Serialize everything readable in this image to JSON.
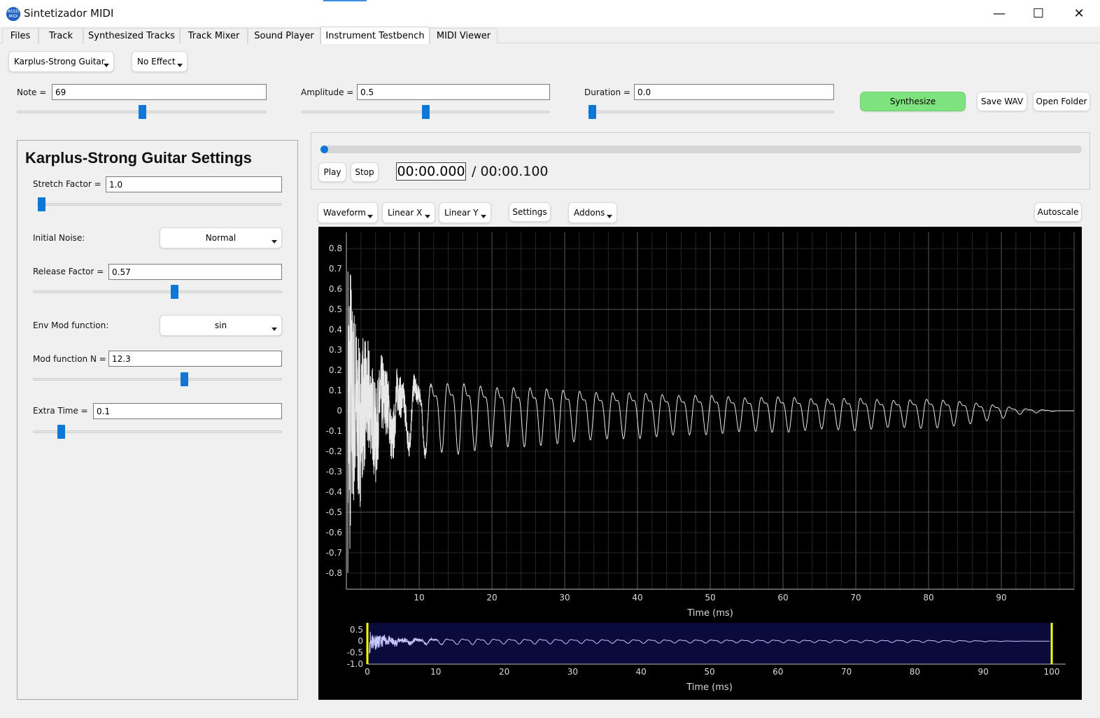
{
  "window": {
    "title": "Sintetizador MIDI",
    "icon_text_top": "ASSD",
    "icon_text_bottom": "MIDI",
    "minimize": "—",
    "maximize": "☐",
    "close": "✕"
  },
  "tabs": [
    {
      "label": "Files"
    },
    {
      "label": "Track"
    },
    {
      "label": "Synthesized Tracks"
    },
    {
      "label": "Track Mixer"
    },
    {
      "label": "Sound Player"
    },
    {
      "label": "Instrument Testbench",
      "active": true
    },
    {
      "label": "MIDI Viewer"
    }
  ],
  "controls": {
    "instrument": "Karplus-Strong Guitar",
    "effect": "No Effect",
    "note_label": "Note =",
    "note_value": "69",
    "note_slider": 0.5,
    "amplitude_label": "Amplitude =",
    "amplitude_value": "0.5",
    "amplitude_slider": 0.5,
    "duration_label": "Duration =",
    "duration_value": "0.0",
    "duration_slider": 0.0,
    "synthesize": "Synthesize",
    "save_wav": "Save WAV",
    "open_folder": "Open Folder"
  },
  "settings": {
    "title": "Karplus-Strong Guitar Settings",
    "stretch_label": "Stretch Factor =",
    "stretch_value": "1.0",
    "stretch_slider": 0.0,
    "noise_label": "Initial Noise:",
    "noise_value": "Normal",
    "release_label": "Release Factor =",
    "release_value": "0.57",
    "release_slider": 0.57,
    "envmod_label": "Env Mod function:",
    "envmod_value": "sin",
    "modn_label": "Mod function N =",
    "modn_value": "12.3",
    "modn_slider": 0.61,
    "extra_label": "Extra Time =",
    "extra_value": "0.1",
    "extra_slider": 0.1
  },
  "player": {
    "play": "Play",
    "stop": "Stop",
    "current_time": "00:00.000",
    "total_time": "/ 00:00.100",
    "progress": 0.0
  },
  "plot_toolbar": {
    "mode": "Waveform",
    "x_scale": "Linear X",
    "y_scale": "Linear Y",
    "settings": "Settings",
    "addons": "Addons",
    "autoscale": "Autoscale"
  },
  "colors": {
    "accent": "#0f78d6",
    "synthesize_bg": "#7ee37e",
    "plot_bg": "#000000",
    "overview_bg": "#0a0a3c",
    "region_marker": "#ffff00"
  },
  "chart_data": [
    {
      "type": "line",
      "title": "",
      "xlabel": "Time (ms)",
      "ylabel": "",
      "xlim": [
        0,
        100
      ],
      "ylim": [
        -0.88,
        0.88
      ],
      "xticks": [
        10,
        20,
        30,
        40,
        50,
        60,
        70,
        80,
        90
      ],
      "yticks": [
        0.8,
        0.7,
        0.6,
        0.5,
        0.4,
        0.3,
        0.2,
        0.1,
        0,
        -0.1,
        -0.2,
        -0.3,
        -0.4,
        -0.5,
        -0.6,
        -0.7,
        -0.8
      ],
      "ytick_labels": [
        "0.8",
        "0.7",
        "0.6",
        "0.5",
        "0.4",
        "0.3",
        "0.2",
        "0.1",
        "0",
        "-0.1",
        "-0.2",
        "-0.3",
        "-0.4",
        "-0.5",
        "-0.6",
        "-0.7",
        "-0.8"
      ],
      "grid": true,
      "series": [
        {
          "x": [
            0.3,
            0.6,
            0.9,
            1.2,
            1.5,
            1.8,
            2.1,
            2.4,
            2.7,
            3.0,
            3.5,
            4.0,
            4.5,
            5.0,
            6.0,
            7.0,
            8.0,
            10.0,
            12.0,
            15.0,
            20.0,
            25.0,
            30.0,
            35.0,
            40.0,
            45.0,
            50.0,
            55.0,
            60.0,
            65.0,
            70.0,
            75.0,
            80.0,
            85.0,
            88.0,
            90.0,
            92.0,
            95.0,
            98.0,
            100.0
          ],
          "y": [
            0.82,
            -0.81,
            0.52,
            -0.63,
            0.42,
            -0.55,
            0.38,
            -0.48,
            0.35,
            -0.42,
            0.33,
            -0.39,
            0.3,
            -0.35,
            0.27,
            -0.3,
            0.24,
            -0.27,
            0.2,
            -0.22,
            0.18,
            -0.18,
            0.16,
            -0.14,
            0.14,
            -0.12,
            0.12,
            -0.1,
            0.11,
            -0.09,
            0.1,
            -0.08,
            0.09,
            -0.07,
            0.05,
            -0.04,
            0.02,
            -0.01,
            0.0,
            0.0
          ]
        }
      ]
    },
    {
      "type": "line",
      "title": "",
      "xlabel": "Time (ms)",
      "ylabel": "",
      "xlim": [
        0,
        100
      ],
      "ylim": [
        -1.0,
        0.8
      ],
      "xticks": [
        0,
        10,
        20,
        30,
        40,
        50,
        60,
        70,
        80,
        90,
        100
      ],
      "yticks": [
        0.5,
        0,
        -0.5,
        -1.0
      ],
      "ytick_labels": [
        "0.5",
        "0",
        "-0.5",
        "-1.0"
      ],
      "grid": false,
      "region": [
        0,
        100
      ]
    }
  ]
}
